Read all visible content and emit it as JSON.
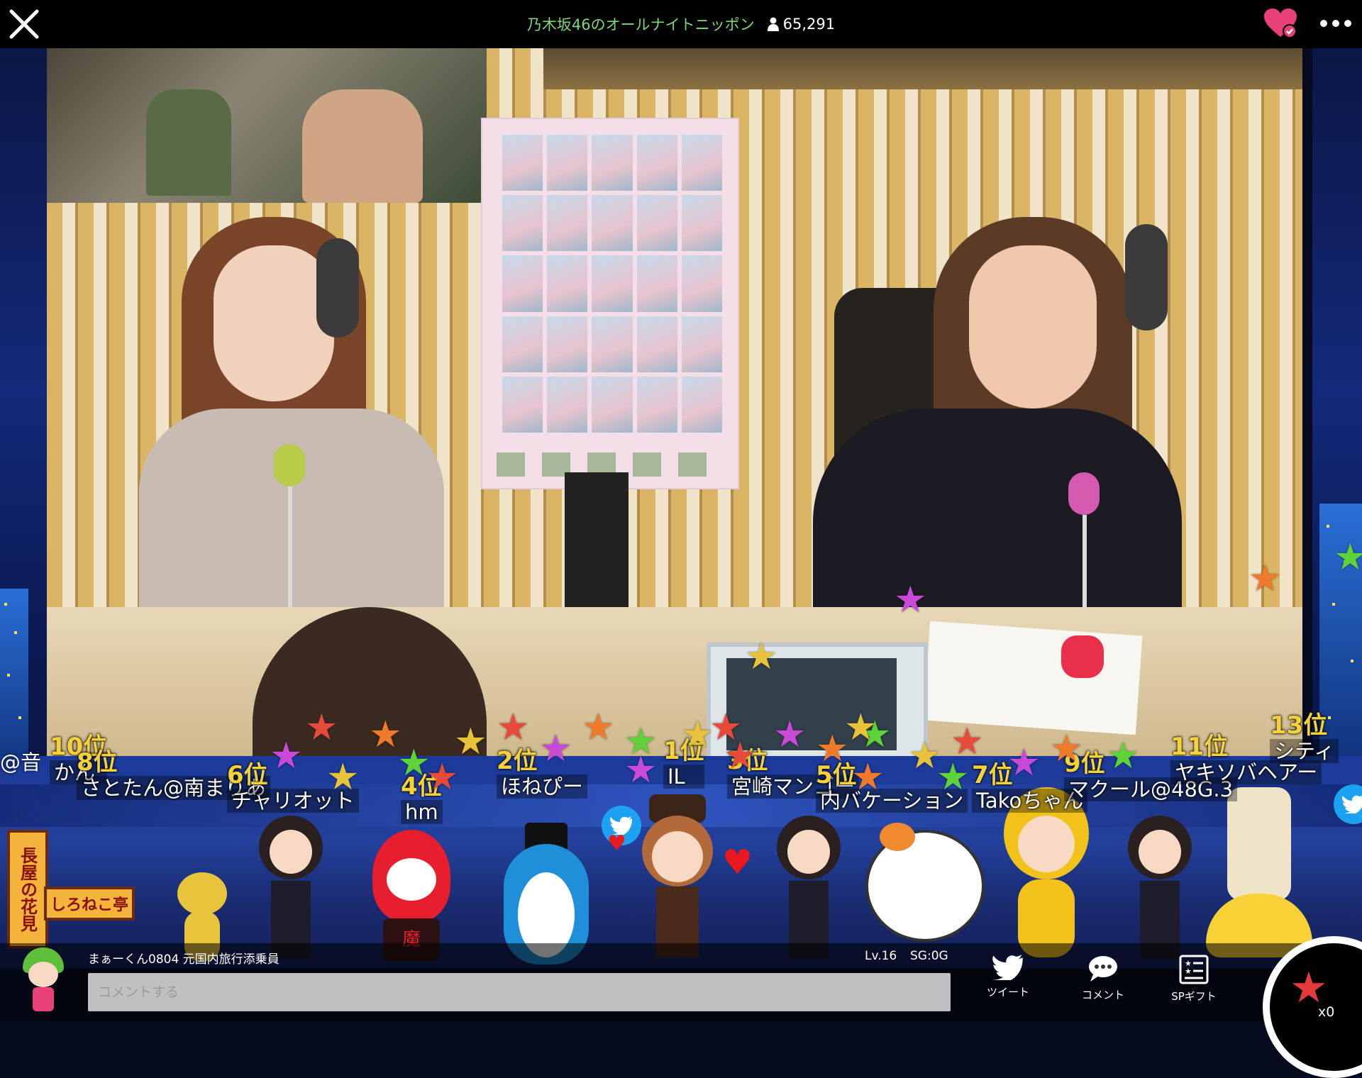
{
  "header": {
    "title": "乃木坂46のオールナイトニッポン",
    "viewer_count": "65,291"
  },
  "ranking": [
    {
      "position": "10位",
      "name": "かん"
    },
    {
      "position": "8位",
      "name": "さとたん@南まりあ"
    },
    {
      "position": "6位",
      "name": "チャリオット"
    },
    {
      "position": "4位",
      "name": "hm"
    },
    {
      "position": "2位",
      "name": "ほねぴー"
    },
    {
      "position": "1位",
      "name": "IL"
    },
    {
      "position": "3位",
      "name": "宮崎マンゴー"
    },
    {
      "position": "5位",
      "name": "内バケーション"
    },
    {
      "position": "7位",
      "name": "Takoちゃん"
    },
    {
      "position": "9位",
      "name": "マクール@48G.3"
    },
    {
      "position": "11位",
      "name": "ヤキソバヘアー"
    },
    {
      "position": "13位",
      "name": "シティ"
    }
  ],
  "left_mention": "@音",
  "signs": {
    "vertical": "長屋の花見",
    "shop": "しろねこ亭"
  },
  "avatar_labels": {
    "rabbit": "魔"
  },
  "user": {
    "name": "まぁーくん0804 元国内旅行添乗員",
    "level": "Lv.16",
    "sg": "SG:0G"
  },
  "comment": {
    "placeholder": "コメントする"
  },
  "actions": {
    "tweet": "ツイート",
    "comment": "コメント",
    "sp_gift": "SPギフト"
  },
  "star_count": "x0",
  "colors": {
    "title_green": "#7fd67a",
    "rank_gold": "#f5d23a",
    "heart_pink": "#e8417a",
    "star_red": "#e63a3a"
  },
  "icons": [
    "close-icon",
    "person-icon",
    "heart-check-icon",
    "more-icon",
    "twitter-icon",
    "speech-bubble-icon",
    "gift-list-icon",
    "star-icon"
  ]
}
